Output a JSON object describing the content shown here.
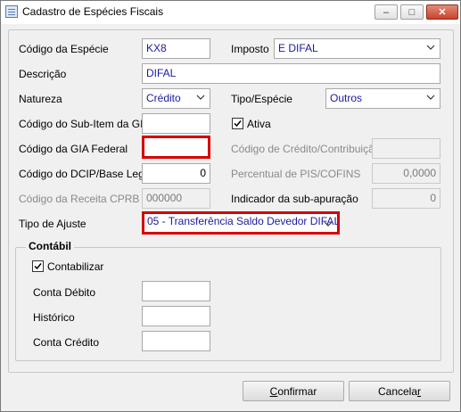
{
  "window": {
    "title": "Cadastro de Espécies Fiscais",
    "min_label": "–",
    "max_label": "□",
    "close_label": "✕"
  },
  "fields": {
    "codigo_especie": {
      "label": "Código da Espécie",
      "value": "KX8"
    },
    "imposto": {
      "label": "Imposto",
      "value": "E DIFAL"
    },
    "descricao": {
      "label": "Descrição",
      "value": "DIFAL"
    },
    "natureza": {
      "label": "Natureza",
      "value": "Crédito"
    },
    "tipo_especie": {
      "label": "Tipo/Espécie",
      "value": "Outros"
    },
    "subitem_gia": {
      "label": "Código do Sub-Item da GIA",
      "value": ""
    },
    "ativa": {
      "label": "Ativa",
      "checked": true
    },
    "gia_federal": {
      "label": "Código da GIA Federal",
      "value": ""
    },
    "credito_contribuicao": {
      "label": "Código de Crédito/Contribuição",
      "value": ""
    },
    "dcip_base_legal": {
      "label": "Código do DCIP/Base Legal",
      "value": "0"
    },
    "percentual_pis_cofins": {
      "label": "Percentual de PIS/COFINS",
      "value": "0,0000"
    },
    "receita_cprb": {
      "label": "Código da Receita CPRB",
      "value": "000000"
    },
    "indicador_subapuracao": {
      "label": "Indicador da sub-apuração",
      "value": "0"
    },
    "tipo_ajuste": {
      "label": "Tipo de Ajuste",
      "value": "05 - Transferência Saldo Devedor DIFAL"
    }
  },
  "contabil": {
    "title": "Contábil",
    "contabilizar": {
      "label": "Contabilizar",
      "checked": true
    },
    "conta_debito": {
      "label": "Conta Débito",
      "value": ""
    },
    "historico": {
      "label": "Histórico",
      "value": ""
    },
    "conta_credito": {
      "label": "Conta Crédito",
      "value": ""
    }
  },
  "buttons": {
    "confirmar_first": "C",
    "confirmar_rest": "onfirmar",
    "cancelar_first": "Cancela",
    "cancelar_rest": "r"
  },
  "colors": {
    "highlight_border": "#d60000",
    "field_text": "#1a1aa0"
  },
  "icons": [
    "app-icon",
    "minimize-icon",
    "maximize-icon",
    "close-icon",
    "chevron-down-icon",
    "checkmark-icon"
  ]
}
